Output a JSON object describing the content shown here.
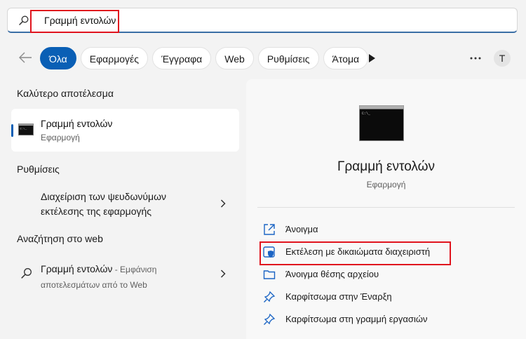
{
  "search": {
    "value": "Γραμμή εντολών",
    "placeholder": ""
  },
  "filters": [
    {
      "label": "Όλα",
      "active": true
    },
    {
      "label": "Εφαρμογές",
      "active": false
    },
    {
      "label": "Έγγραφα",
      "active": false
    },
    {
      "label": "Web",
      "active": false
    },
    {
      "label": "Ρυθμίσεις",
      "active": false
    },
    {
      "label": "Άτομα",
      "active": false
    }
  ],
  "account": {
    "initial": "T"
  },
  "left": {
    "best_match_title": "Καλύτερο αποτέλεσμα",
    "best_match": {
      "name": "Γραμμή εντολών",
      "type": "Εφαρμογή"
    },
    "settings_title": "Ρυθμίσεις",
    "setting_item": "Διαχείριση των ψευδωνύμων εκτέλεσης της εφαρμογής",
    "web_title": "Αναζήτηση στο web",
    "web_item": {
      "query": "Γραμμή εντολών",
      "suffix": " - Εμφάνιση αποτελεσμάτων από το Web"
    }
  },
  "right": {
    "app_name": "Γραμμή εντολών",
    "app_type": "Εφαρμογή",
    "actions": [
      {
        "label": "Άνοιγμα",
        "icon": "open-external-icon"
      },
      {
        "label": "Εκτέλεση με δικαιώματα διαχειριστή",
        "icon": "shield-admin-icon"
      },
      {
        "label": "Άνοιγμα θέσης αρχείου",
        "icon": "folder-icon"
      },
      {
        "label": "Καρφίτσωμα στην Έναρξη",
        "icon": "pin-icon"
      },
      {
        "label": "Καρφίτσωμα στη γραμμή εργασιών",
        "icon": "pin-icon"
      }
    ]
  },
  "colors": {
    "accent": "#0a5fb5",
    "highlight": "#e0141e"
  }
}
